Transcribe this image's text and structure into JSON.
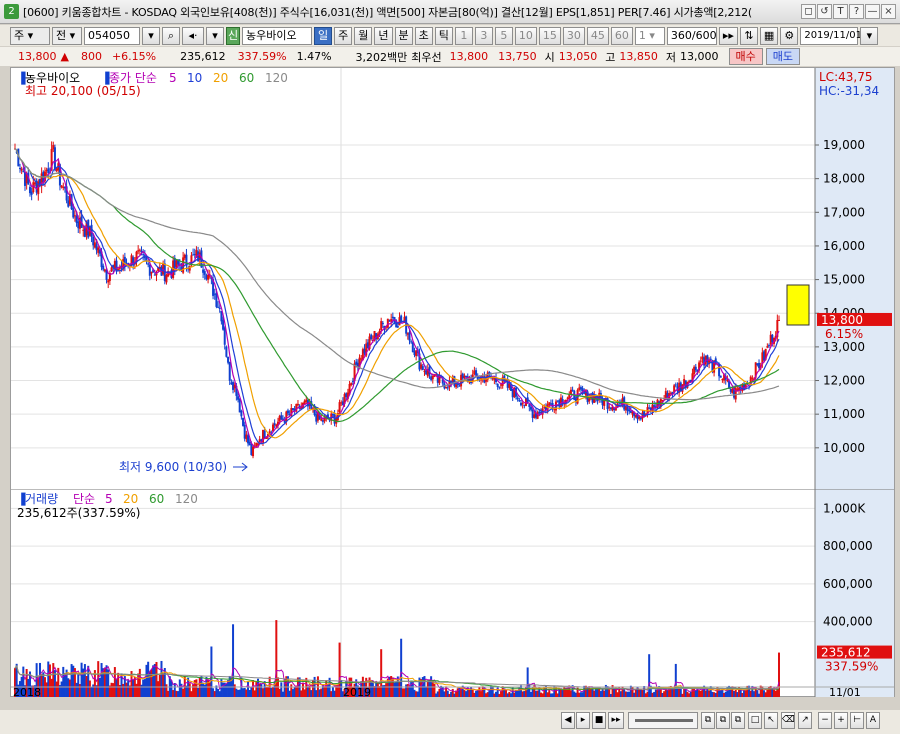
{
  "window": {
    "title": "[0600] 키움종합차트 - KOSDAQ 외국인보유[408(천)] 주식수[16,031(천)] 액면[500] 자본금[80(억)] 결산[12월] EPS[1,851] PER[7.46] 시가총액[2,212(",
    "icon_label": "2",
    "buttons": [
      "◻",
      "↺",
      "T",
      "?",
      "—",
      "×"
    ]
  },
  "toolbar": {
    "period": "주",
    "chart_type": "전",
    "code": "054050",
    "stock_name": "농우바이오",
    "stock_badge": "신",
    "interval_buttons": [
      "일",
      "주",
      "월",
      "년",
      "분",
      "초",
      "틱"
    ],
    "interval_numbers": [
      "1",
      "3",
      "5",
      "10",
      "15",
      "30",
      "45",
      "60"
    ],
    "count_select": "1",
    "range": "360",
    "range_total": "/600",
    "date": "2019/11/01"
  },
  "quote": {
    "price": "13,800",
    "change_arrow": "▲",
    "change": "800",
    "change_pct": "+6.15%",
    "volume": "235,612",
    "volume_pct": "337.59%",
    "turnover": "1.47%",
    "trade_value": "3,202백만",
    "best_ask_label": "최우선",
    "best_ask": "13,800",
    "best_bid": "13,750",
    "open_label": "시",
    "open": "13,050",
    "high_label": "고",
    "high": "13,850",
    "low_label": "저",
    "low": "13,000",
    "buy_button": "매수",
    "sell_button": "매도"
  },
  "price_panel": {
    "stock_label": "농우바이오",
    "legend_prefix": "종가 단순",
    "ma_periods": [
      "5",
      "10",
      "20",
      "60",
      "120"
    ],
    "ma_colors": [
      "#b400b4",
      "#1f3fd6",
      "#f0a000",
      "#2f9a2f",
      "#8a8a8a"
    ],
    "high_note": "최고 20,100 (05/15)",
    "low_note": "최저 9,600 (10/30)",
    "lc_label": "LC:43,75",
    "hc_label": "HC:-31,34",
    "current_price_label": "13,800",
    "current_pct_label": "6.15%",
    "y_ticks": [
      "19,000",
      "18,000",
      "17,000",
      "16,000",
      "15,000",
      "14,000",
      "13,000",
      "12,000",
      "11,000",
      "10,000"
    ]
  },
  "volume_panel": {
    "legend_title": "거래량",
    "legend_prefix": "단순",
    "ma_periods": [
      "5",
      "20",
      "60",
      "120"
    ],
    "value_note": "235,612주(337.59%)",
    "y_ticks": [
      "1,000K",
      "800,000",
      "600,000",
      "400,000"
    ],
    "current_label": "235,612",
    "current_pct": "337.59%"
  },
  "x_axis": {
    "labels": [
      "2018",
      "2019"
    ],
    "right_label": "11/01"
  },
  "chart_data": [
    {
      "type": "candlestick",
      "title": "농우바이오",
      "x_range": [
        "2018-01",
        "2019-11-01"
      ],
      "ylim": [
        9400,
        20100
      ],
      "series": [
        {
          "name": "종가 단순 5"
        },
        {
          "name": "10"
        },
        {
          "name": "20"
        },
        {
          "name": "60"
        },
        {
          "name": "120"
        }
      ],
      "close_path": [
        {
          "x": 0.0,
          "y": 18900
        },
        {
          "x": 0.02,
          "y": 17600
        },
        {
          "x": 0.04,
          "y": 18200
        },
        {
          "x": 0.05,
          "y": 18700
        },
        {
          "x": 0.06,
          "y": 17900
        },
        {
          "x": 0.08,
          "y": 16800
        },
        {
          "x": 0.1,
          "y": 16300
        },
        {
          "x": 0.12,
          "y": 15200
        },
        {
          "x": 0.14,
          "y": 15400
        },
        {
          "x": 0.16,
          "y": 15700
        },
        {
          "x": 0.18,
          "y": 15300
        },
        {
          "x": 0.2,
          "y": 15200
        },
        {
          "x": 0.22,
          "y": 15500
        },
        {
          "x": 0.24,
          "y": 15700
        },
        {
          "x": 0.25,
          "y": 15300
        },
        {
          "x": 0.27,
          "y": 14000
        },
        {
          "x": 0.28,
          "y": 12200
        },
        {
          "x": 0.29,
          "y": 11700
        },
        {
          "x": 0.3,
          "y": 10500
        },
        {
          "x": 0.31,
          "y": 9800
        },
        {
          "x": 0.32,
          "y": 10300
        },
        {
          "x": 0.34,
          "y": 10700
        },
        {
          "x": 0.36,
          "y": 11000
        },
        {
          "x": 0.38,
          "y": 11300
        },
        {
          "x": 0.4,
          "y": 10800
        },
        {
          "x": 0.42,
          "y": 10900
        },
        {
          "x": 0.44,
          "y": 12000
        },
        {
          "x": 0.45,
          "y": 12700
        },
        {
          "x": 0.47,
          "y": 13300
        },
        {
          "x": 0.49,
          "y": 13900
        },
        {
          "x": 0.51,
          "y": 13700
        },
        {
          "x": 0.53,
          "y": 12500
        },
        {
          "x": 0.55,
          "y": 12000
        },
        {
          "x": 0.57,
          "y": 11900
        },
        {
          "x": 0.6,
          "y": 12100
        },
        {
          "x": 0.62,
          "y": 12100
        },
        {
          "x": 0.64,
          "y": 11900
        },
        {
          "x": 0.66,
          "y": 11500
        },
        {
          "x": 0.68,
          "y": 11000
        },
        {
          "x": 0.7,
          "y": 11300
        },
        {
          "x": 0.72,
          "y": 11500
        },
        {
          "x": 0.74,
          "y": 11600
        },
        {
          "x": 0.76,
          "y": 11500
        },
        {
          "x": 0.78,
          "y": 11300
        },
        {
          "x": 0.8,
          "y": 11300
        },
        {
          "x": 0.82,
          "y": 10900
        },
        {
          "x": 0.84,
          "y": 11300
        },
        {
          "x": 0.86,
          "y": 11700
        },
        {
          "x": 0.88,
          "y": 12000
        },
        {
          "x": 0.9,
          "y": 12700
        },
        {
          "x": 0.92,
          "y": 12300
        },
        {
          "x": 0.94,
          "y": 11600
        },
        {
          "x": 0.96,
          "y": 12000
        },
        {
          "x": 0.98,
          "y": 12700
        },
        {
          "x": 1.0,
          "y": 13800
        }
      ]
    },
    {
      "type": "bar",
      "title": "거래량",
      "ylim": [
        0,
        1050000
      ],
      "last_value": 235612
    }
  ]
}
